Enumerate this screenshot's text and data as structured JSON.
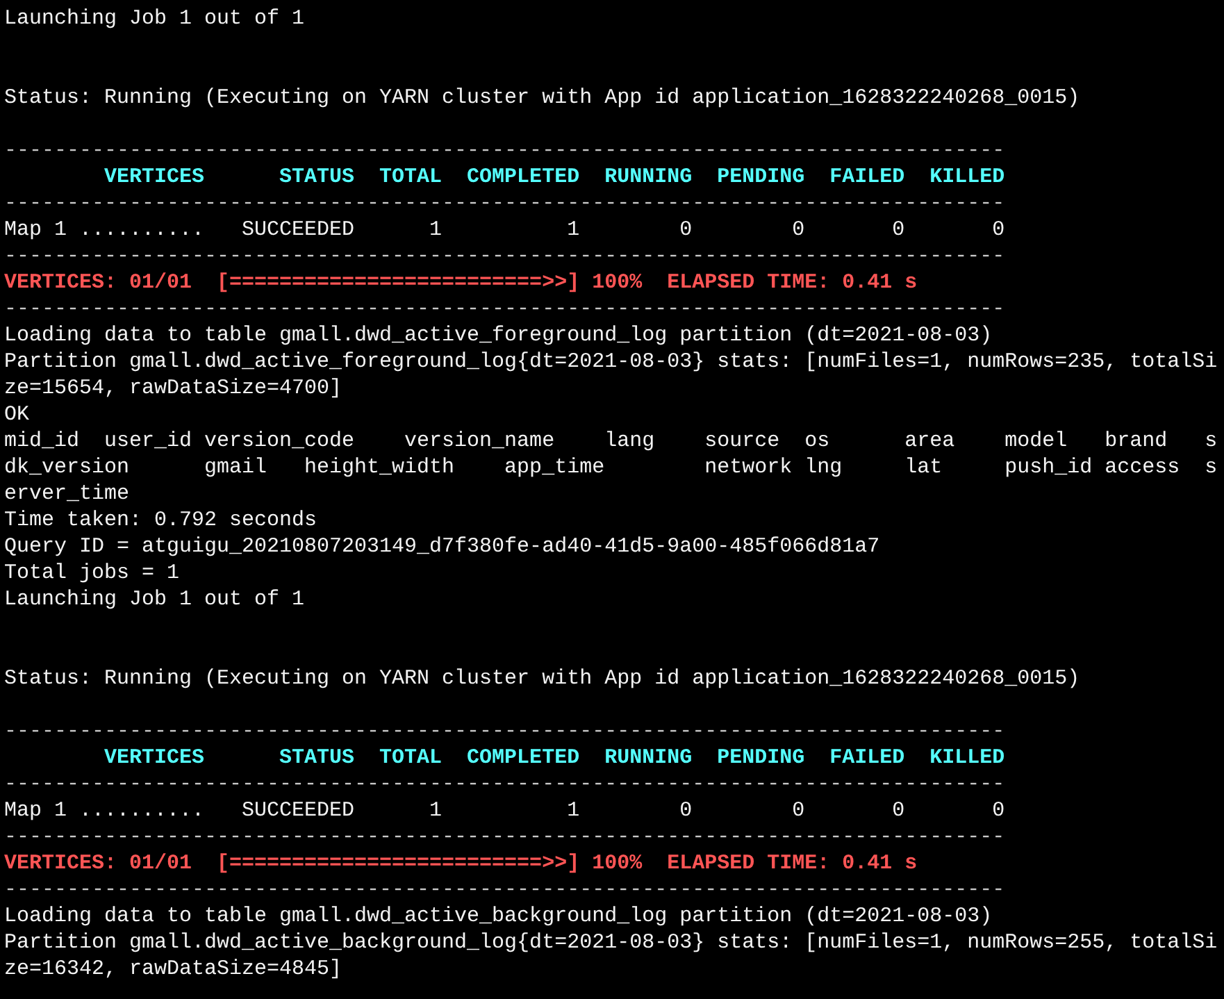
{
  "terminal": {
    "lines": [
      {
        "kind": "text",
        "text": "Launching Job 1 out of 1"
      },
      {
        "kind": "blank"
      },
      {
        "kind": "blank"
      },
      {
        "kind": "text",
        "text": "Status: Running (Executing on YARN cluster with App id application_1628322240268_0015)"
      },
      {
        "kind": "blank"
      },
      {
        "kind": "rule",
        "text": "--------------------------------------------------------------------------------"
      },
      {
        "kind": "header",
        "text": "        VERTICES      STATUS  TOTAL  COMPLETED  RUNNING  PENDING  FAILED  KILLED"
      },
      {
        "kind": "rule",
        "text": "--------------------------------------------------------------------------------"
      },
      {
        "kind": "text",
        "text": "Map 1 ..........   SUCCEEDED      1          1        0        0       0       0"
      },
      {
        "kind": "rule",
        "text": "--------------------------------------------------------------------------------"
      },
      {
        "kind": "progress",
        "text": "VERTICES: 01/01  [=========================>>] 100%  ELAPSED TIME: 0.41 s"
      },
      {
        "kind": "rule",
        "text": "--------------------------------------------------------------------------------"
      },
      {
        "kind": "text",
        "text": "Loading data to table gmall.dwd_active_foreground_log partition (dt=2021-08-03)"
      },
      {
        "kind": "text",
        "text": "Partition gmall.dwd_active_foreground_log{dt=2021-08-03} stats: [numFiles=1, numRows=235, totalSi"
      },
      {
        "kind": "text",
        "text": "ze=15654, rawDataSize=4700]"
      },
      {
        "kind": "text",
        "text": "OK"
      },
      {
        "kind": "text",
        "text": "mid_id  user_id version_code    version_name    lang    source  os      area    model   brand   s"
      },
      {
        "kind": "text",
        "text": "dk_version      gmail   height_width    app_time        network lng     lat     push_id access  s"
      },
      {
        "kind": "text",
        "text": "erver_time"
      },
      {
        "kind": "text",
        "text": "Time taken: 0.792 seconds"
      },
      {
        "kind": "text",
        "text": "Query ID = atguigu_20210807203149_d7f380fe-ad40-41d5-9a00-485f066d81a7"
      },
      {
        "kind": "text",
        "text": "Total jobs = 1"
      },
      {
        "kind": "text",
        "text": "Launching Job 1 out of 1"
      },
      {
        "kind": "blank"
      },
      {
        "kind": "blank"
      },
      {
        "kind": "text",
        "text": "Status: Running (Executing on YARN cluster with App id application_1628322240268_0015)"
      },
      {
        "kind": "blank"
      },
      {
        "kind": "rule",
        "text": "--------------------------------------------------------------------------------"
      },
      {
        "kind": "header",
        "text": "        VERTICES      STATUS  TOTAL  COMPLETED  RUNNING  PENDING  FAILED  KILLED"
      },
      {
        "kind": "rule",
        "text": "--------------------------------------------------------------------------------"
      },
      {
        "kind": "text",
        "text": "Map 1 ..........   SUCCEEDED      1          1        0        0       0       0"
      },
      {
        "kind": "rule",
        "text": "--------------------------------------------------------------------------------"
      },
      {
        "kind": "progress",
        "text": "VERTICES: 01/01  [=========================>>] 100%  ELAPSED TIME: 0.41 s"
      },
      {
        "kind": "rule",
        "text": "--------------------------------------------------------------------------------"
      },
      {
        "kind": "text",
        "text": "Loading data to table gmall.dwd_active_background_log partition (dt=2021-08-03)"
      },
      {
        "kind": "text",
        "text": "Partition gmall.dwd_active_background_log{dt=2021-08-03} stats: [numFiles=1, numRows=255, totalSi"
      },
      {
        "kind": "text",
        "text": "ze=16342, rawDataSize=4845]"
      }
    ]
  }
}
